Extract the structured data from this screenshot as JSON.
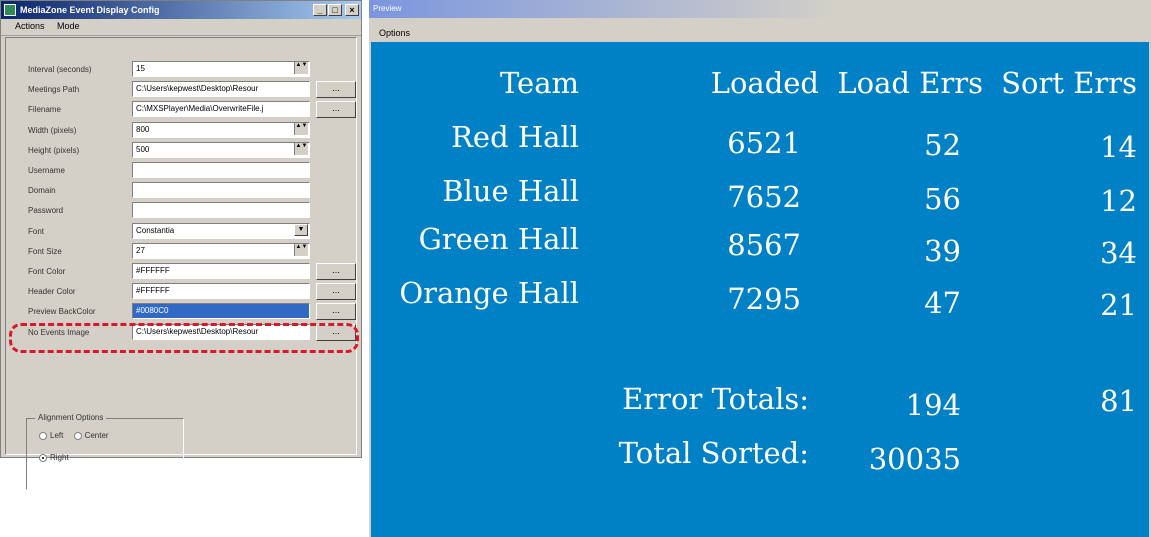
{
  "config_window": {
    "title": "MediaZone Event Display Config",
    "buttons": {
      "minimize": "_",
      "maximize": "□",
      "close": "×"
    },
    "menu": [
      "Actions",
      "Mode"
    ],
    "fields": [
      {
        "label": "Interval (seconds)",
        "value": "15",
        "control": "spin"
      },
      {
        "label": "Meetings Path",
        "value": "C:\\Users\\kepwest\\Desktop\\Resour",
        "control": "browse"
      },
      {
        "label": "Filename",
        "value": "C:\\MXSPlayer\\Media\\OverwriteFile.j",
        "control": "browse"
      },
      {
        "label": "Width (pixels)",
        "value": "800",
        "control": "spin"
      },
      {
        "label": "Height (pixels)",
        "value": "500",
        "control": "spin"
      },
      {
        "label": "Username",
        "value": "",
        "control": "none"
      },
      {
        "label": "Domain",
        "value": "",
        "control": "none"
      },
      {
        "label": "Password",
        "value": "",
        "control": "none"
      },
      {
        "label": "Font",
        "value": "Constantia",
        "control": "dropdown"
      },
      {
        "label": "Font Size",
        "value": "27",
        "control": "spin"
      },
      {
        "label": "Font Color",
        "value": "#FFFFFF",
        "control": "browse"
      },
      {
        "label": "Header Color",
        "value": "#FFFFFF",
        "control": "browse"
      },
      {
        "label": "Preview BackColor",
        "value": "#0080C0",
        "control": "browse",
        "selected": true
      },
      {
        "label": "No Events Image",
        "value": "C:\\Users\\kepwest\\Desktop\\Resour",
        "control": "browse"
      }
    ],
    "browse_label": "...",
    "spin_glyph": "▲▼",
    "dropdown_glyph": "▼",
    "alignment": {
      "legend": "Alignment Options",
      "options": [
        "Left",
        "Center",
        "Right"
      ],
      "selected": "Right"
    },
    "highlight_color": "#d7192b"
  },
  "preview_window": {
    "title": "Preview",
    "menu": [
      "Options"
    ],
    "background_color": "#0081c6",
    "table": {
      "headers": [
        "Team",
        "Loaded",
        "Load Errs",
        "Sort Errs"
      ],
      "rows": [
        [
          "Red Hall",
          "6521",
          "52",
          "14"
        ],
        [
          "Blue Hall",
          "7652",
          "56",
          "12"
        ],
        [
          "Green Hall",
          "8567",
          "39",
          "34"
        ],
        [
          "Orange Hall",
          "7295",
          "47",
          "21"
        ]
      ]
    },
    "totals": {
      "error_label": "Error Totals:",
      "error_load": "194",
      "error_sort": "81",
      "sorted_label": "Total Sorted:",
      "sorted_value": "30035"
    }
  }
}
